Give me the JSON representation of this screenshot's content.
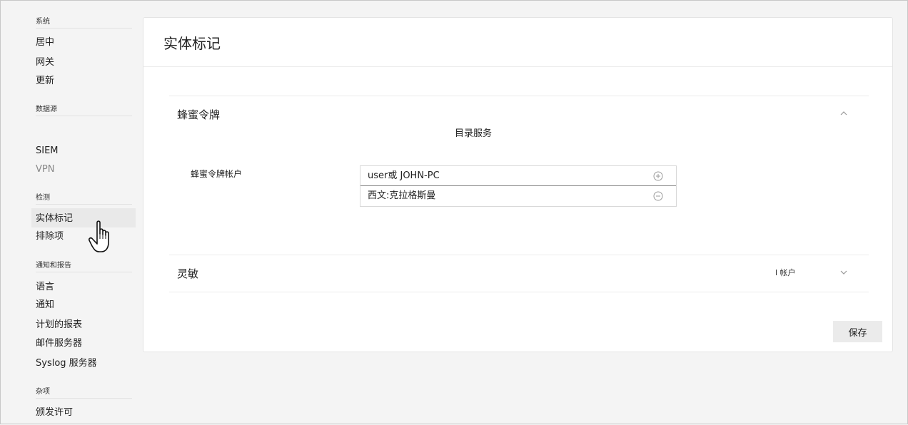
{
  "sidebar": {
    "sections": [
      {
        "title": "系统",
        "items": [
          "居中",
          "网关",
          "更新"
        ]
      },
      {
        "title": "数据源",
        "items": [
          "SIEM",
          "VPN"
        ]
      },
      {
        "title": "检测",
        "items": [
          "实体标记",
          "排除项"
        ]
      },
      {
        "title": "通知和报告",
        "items": [
          "语言",
          "通知",
          "计划的报表",
          "邮件服务器",
          "Syslog 服务器"
        ]
      },
      {
        "title": "杂项",
        "items": [
          "颁发许可"
        ]
      }
    ],
    "selected": "实体标记"
  },
  "page": {
    "title": "实体标记"
  },
  "honeytoken": {
    "title": "蜂蜜令牌",
    "directory_label": "目录服务",
    "field_label": "蜂蜜令牌帐户",
    "accounts": [
      {
        "value": "user或 JOHN-PC",
        "icon": "plus-circle-icon"
      },
      {
        "value": "西文:克拉格斯曼",
        "icon": "minus-circle-icon"
      }
    ]
  },
  "sensitive": {
    "title": "灵敏",
    "right_label": "l 帐户"
  },
  "actions": {
    "save_label": "保存"
  }
}
